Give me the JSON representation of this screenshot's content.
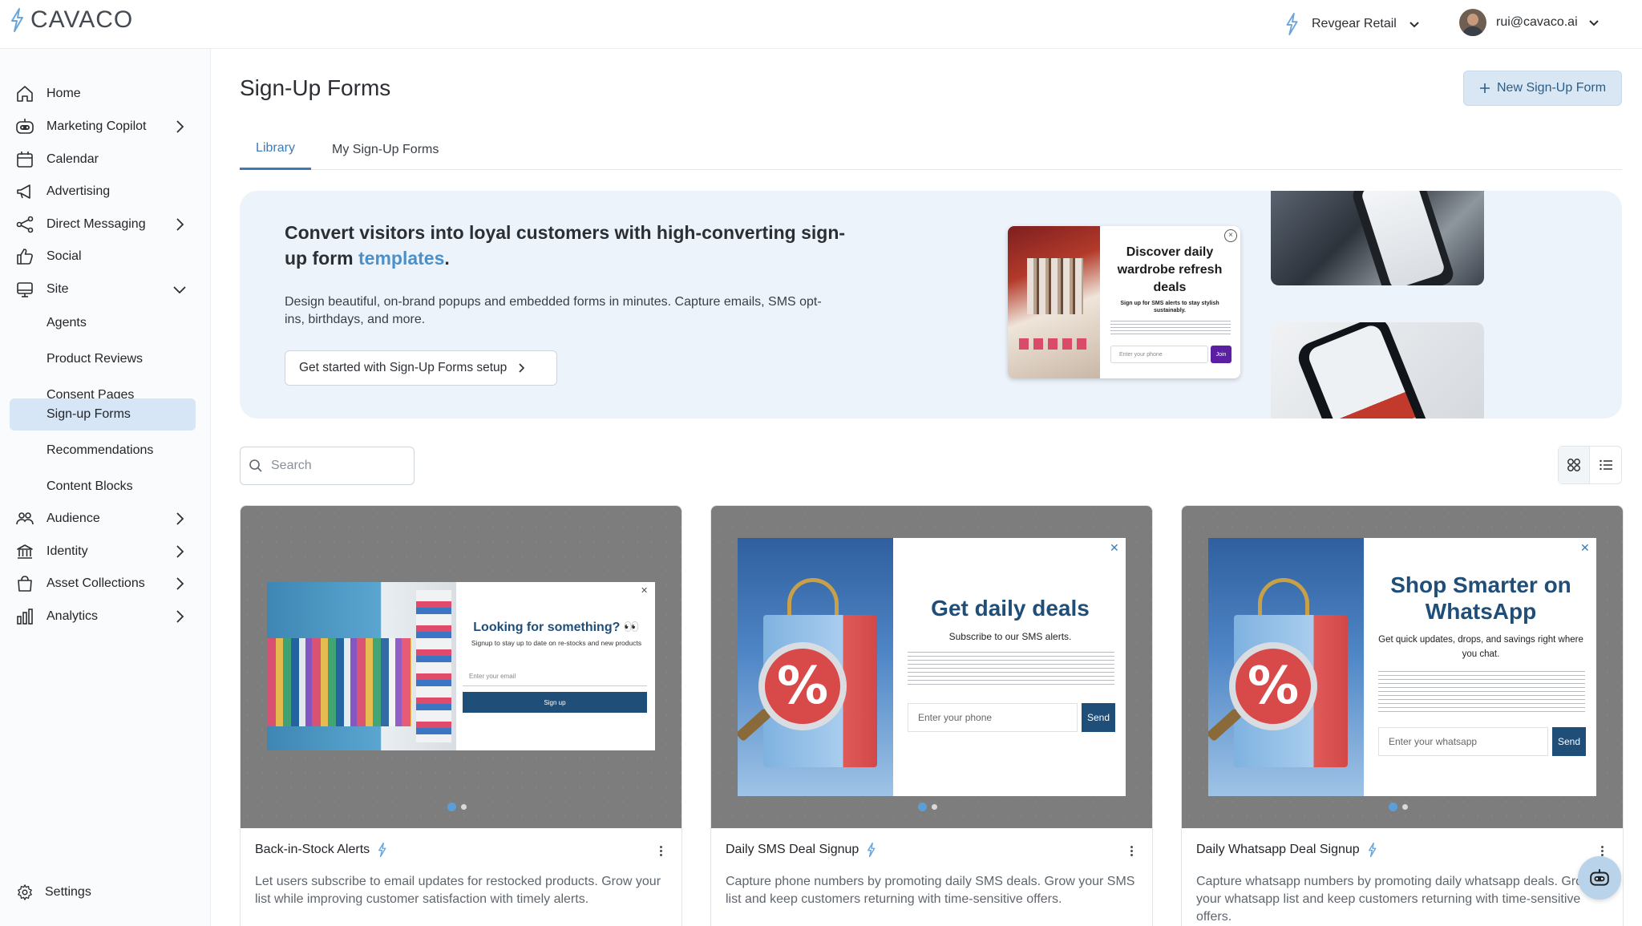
{
  "app": {
    "logo_text": "CAVACO"
  },
  "header": {
    "store_name": "Revgear Retail",
    "user_email": "rui@cavaco.ai"
  },
  "sidebar": {
    "items": [
      {
        "label": "Home",
        "icon": "home-icon"
      },
      {
        "label": "Marketing Copilot",
        "icon": "robot-icon"
      },
      {
        "label": "Calendar",
        "icon": "calendar-icon"
      },
      {
        "label": "Advertising",
        "icon": "megaphone-icon"
      },
      {
        "label": "Direct Messaging",
        "icon": "share-icon"
      },
      {
        "label": "Social",
        "icon": "thumbs-up-icon"
      },
      {
        "label": "Site",
        "icon": "monitor-icon"
      }
    ],
    "site_children": [
      "Agents",
      "Product Reviews",
      "Consent Pages",
      "Sign-up Forms",
      "Recommendations",
      "Content Blocks"
    ],
    "active_child": "Sign-up Forms",
    "items_lower": [
      {
        "label": "Audience",
        "icon": "users-icon"
      },
      {
        "label": "Identity",
        "icon": "bank-icon"
      },
      {
        "label": "Asset Collections",
        "icon": "shopping-bag-icon"
      },
      {
        "label": "Analytics",
        "icon": "bar-chart-icon"
      }
    ],
    "settings_label": "Settings"
  },
  "main": {
    "title": "Sign-Up Forms",
    "new_button_label": "New Sign-Up Form",
    "tabs": [
      {
        "label": "Library",
        "active": true
      },
      {
        "label": "My Sign-Up Forms",
        "active": false
      }
    ],
    "banner": {
      "headline_pre": "Convert visitors into loyal customers with high-converting sign-up form ",
      "headline_accent": "templates",
      "headline_post": ".",
      "description": "Design beautiful, on-brand popups and embedded forms in minutes. Capture emails, SMS opt-ins, birthdays, and more.",
      "cta_label": "Get started with Sign-Up Forms setup",
      "promo": {
        "title": "Discover daily wardrobe refresh deals",
        "subtitle": "Sign up for SMS alerts to stay stylish sustainably.",
        "input_placeholder": "Enter your phone",
        "button": "Join"
      }
    },
    "search": {
      "placeholder": "Search"
    },
    "cards": [
      {
        "title": "Back-in-Stock Alerts",
        "description": "Let users subscribe to email updates for restocked products. Grow your list while improving customer satisfaction with timely alerts.",
        "preview": {
          "title": "Looking for something? 👀",
          "subtitle": "Signup to stay up to date on re-stocks and new products",
          "input_placeholder": "Enter your email",
          "button": "Sign up"
        }
      },
      {
        "title": "Daily SMS Deal Signup",
        "description": "Capture phone numbers by promoting daily SMS deals. Grow your SMS list and keep customers returning with time-sensitive offers.",
        "preview": {
          "title": "Get daily deals",
          "subtitle": "Subscribe to our SMS alerts.",
          "input_placeholder": "Enter your phone",
          "button": "Send"
        }
      },
      {
        "title": "Daily Whatsapp Deal Signup",
        "description": "Capture whatsapp numbers by promoting daily whatsapp deals. Grow your whatsapp list and keep customers returning with time-sensitive offers.",
        "preview": {
          "title": "Shop Smarter on WhatsApp",
          "subtitle": "Get quick updates, drops, and savings right where you chat.",
          "input_placeholder": "Enter your whatsapp",
          "button": "Send"
        }
      }
    ]
  },
  "colors": {
    "accent": "#3b7cb8",
    "active_nav": "#d6e6f6",
    "banner_bg": "#edf3fa",
    "brand_navy": "#1f4e79"
  }
}
